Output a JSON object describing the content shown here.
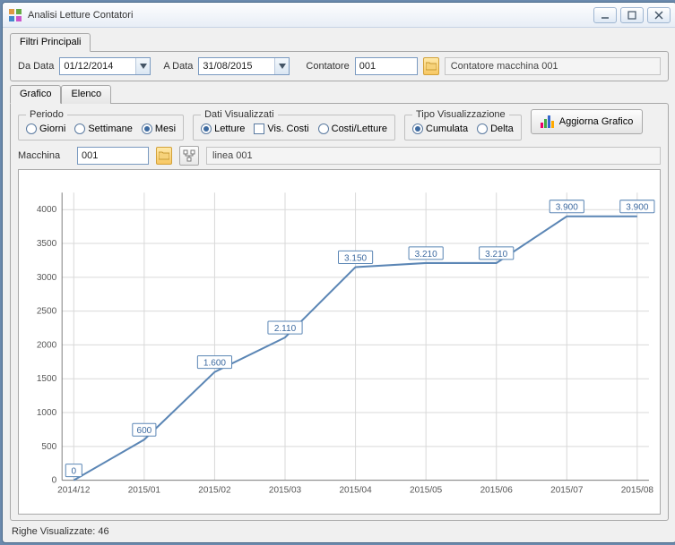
{
  "window": {
    "title": "Analisi Letture Contatori"
  },
  "filters": {
    "tab_label": "Filtri Principali",
    "da_data_label": "Da Data",
    "da_data_value": "01/12/2014",
    "a_data_label": "A Data",
    "a_data_value": "31/08/2015",
    "contatore_label": "Contatore",
    "contatore_value": "001",
    "contatore_desc": "Contatore macchina 001"
  },
  "tabs": {
    "grafico": "Grafico",
    "elenco": "Elenco"
  },
  "periodo": {
    "legend": "Periodo",
    "giorni": "Giorni",
    "settimane": "Settimane",
    "mesi": "Mesi",
    "selected": "mesi"
  },
  "dati": {
    "legend": "Dati Visualizzati",
    "letture": "Letture",
    "vis_costi": "Vis. Costi",
    "costi_letture": "Costi/Letture",
    "selected": "letture",
    "vis_costi_checked": false
  },
  "tipo": {
    "legend": "Tipo Visualizzazione",
    "cumulata": "Cumulata",
    "delta": "Delta",
    "selected": "cumulata"
  },
  "aggiorna_label": "Aggiorna Grafico",
  "macchina": {
    "label": "Macchina",
    "value": "001",
    "desc": "linea 001"
  },
  "status": {
    "label": "Righe Visualizzate: 46"
  },
  "chart_data": {
    "type": "line",
    "xlabel": "",
    "ylabel": "",
    "ylim": [
      0,
      4250
    ],
    "yticks": [
      0,
      500,
      1000,
      1500,
      2000,
      2500,
      3000,
      3500,
      4000
    ],
    "categories": [
      "2014/12",
      "2015/01",
      "2015/02",
      "2015/03",
      "2015/04",
      "2015/05",
      "2015/06",
      "2015/07",
      "2015/08"
    ],
    "values": [
      0,
      600,
      1600,
      2110,
      3150,
      3210,
      3210,
      3900,
      3900
    ],
    "labels": [
      "0",
      "600",
      "1.600",
      "2.110",
      "3.150",
      "3.210",
      "3.210",
      "3.900",
      "3.900"
    ]
  }
}
